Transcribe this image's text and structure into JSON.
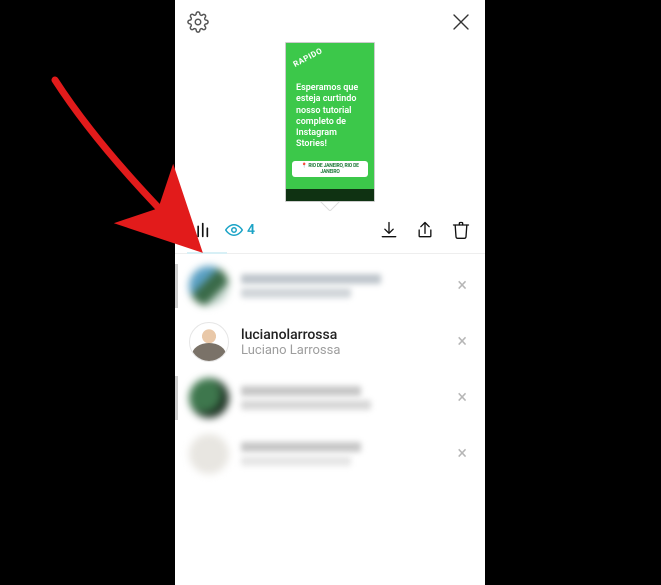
{
  "story_preview": {
    "sticker": "RAPIDO",
    "body": "Esperamos que\nesteja curtindo\nnosso tutorial\ncompleto de\nInstagram\nStories!",
    "location_pill": "📍 RIO DE JANEIRO, RIO DE JANEIRO"
  },
  "toolbar": {
    "views_count": "4"
  },
  "viewers": [
    {
      "username_masked": true,
      "subtitle_masked": true,
      "has_left_bar": true,
      "avatar_variant": "av-blur1"
    },
    {
      "username": "lucianolarrossa",
      "subtitle": "Luciano Larrossa",
      "has_left_bar": false,
      "avatar_variant": "av-person"
    },
    {
      "username_masked": true,
      "subtitle_masked": true,
      "has_left_bar": true,
      "avatar_variant": "av-blur3"
    },
    {
      "username_masked": true,
      "subtitle_masked": true,
      "has_left_bar": false,
      "avatar_variant": "av-blur4"
    }
  ],
  "annotation": {
    "arrow_color": "#e21b1b"
  }
}
